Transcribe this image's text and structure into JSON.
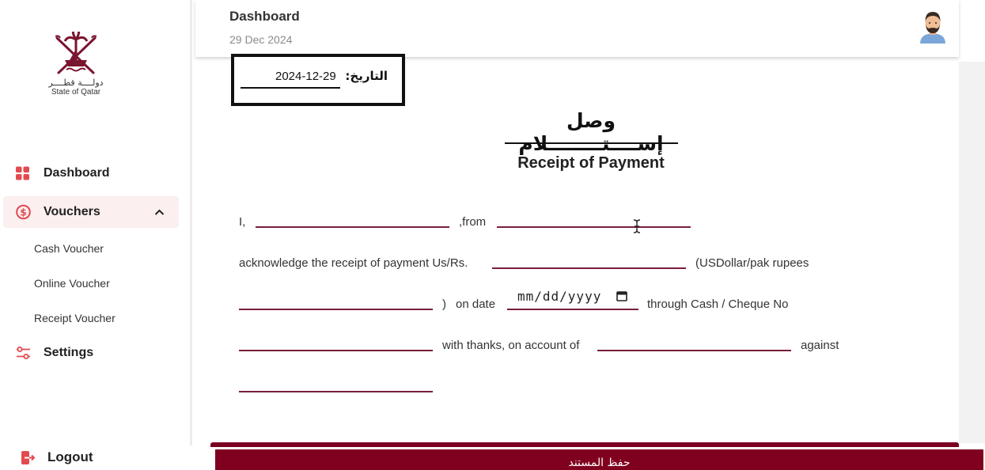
{
  "sidebar": {
    "logo": {
      "arabic": "دولــــة قطــــر",
      "english": "State of Qatar"
    },
    "items": [
      {
        "label": "Dashboard",
        "icon": "grid-icon"
      },
      {
        "label": "Vouchers",
        "icon": "dollar-circle-icon",
        "expanded": true
      },
      {
        "label": "Settings",
        "icon": "sliders-icon"
      }
    ],
    "sub_items": [
      "Cash Voucher",
      "Online Voucher",
      "Receipt Voucher"
    ],
    "logout_label": "Logout"
  },
  "header": {
    "title": "Dashboard",
    "date": "29 Dec 2024"
  },
  "receipt": {
    "date_label": "التاريخ:",
    "date_value": "2024-12-29",
    "title_ar": "وصل إســــتــــــــلام",
    "title_en": "Receipt of Payment",
    "texts": {
      "i": "I,",
      "from": ",from",
      "acknowledge": "acknowledge the receipt of payment Us/Rs.",
      "currency": "(USDollar/pak rupees",
      "paren_close": ")",
      "on_date": "on date",
      "through": "through Cash / Cheque No",
      "with_thanks": "with thanks, on account of",
      "against": "against"
    },
    "date_placeholder": "mm/dd/yyyy",
    "fields": {
      "name": "",
      "from": "",
      "amount": "",
      "amount_words": "",
      "cheque_no": "",
      "account_of": "",
      "against": ""
    }
  },
  "footer": {
    "save_label": "حفظ المستند"
  },
  "colors": {
    "accent": "#800020",
    "icon_red": "#e34a4f",
    "active_bg": "#fbeff0"
  }
}
